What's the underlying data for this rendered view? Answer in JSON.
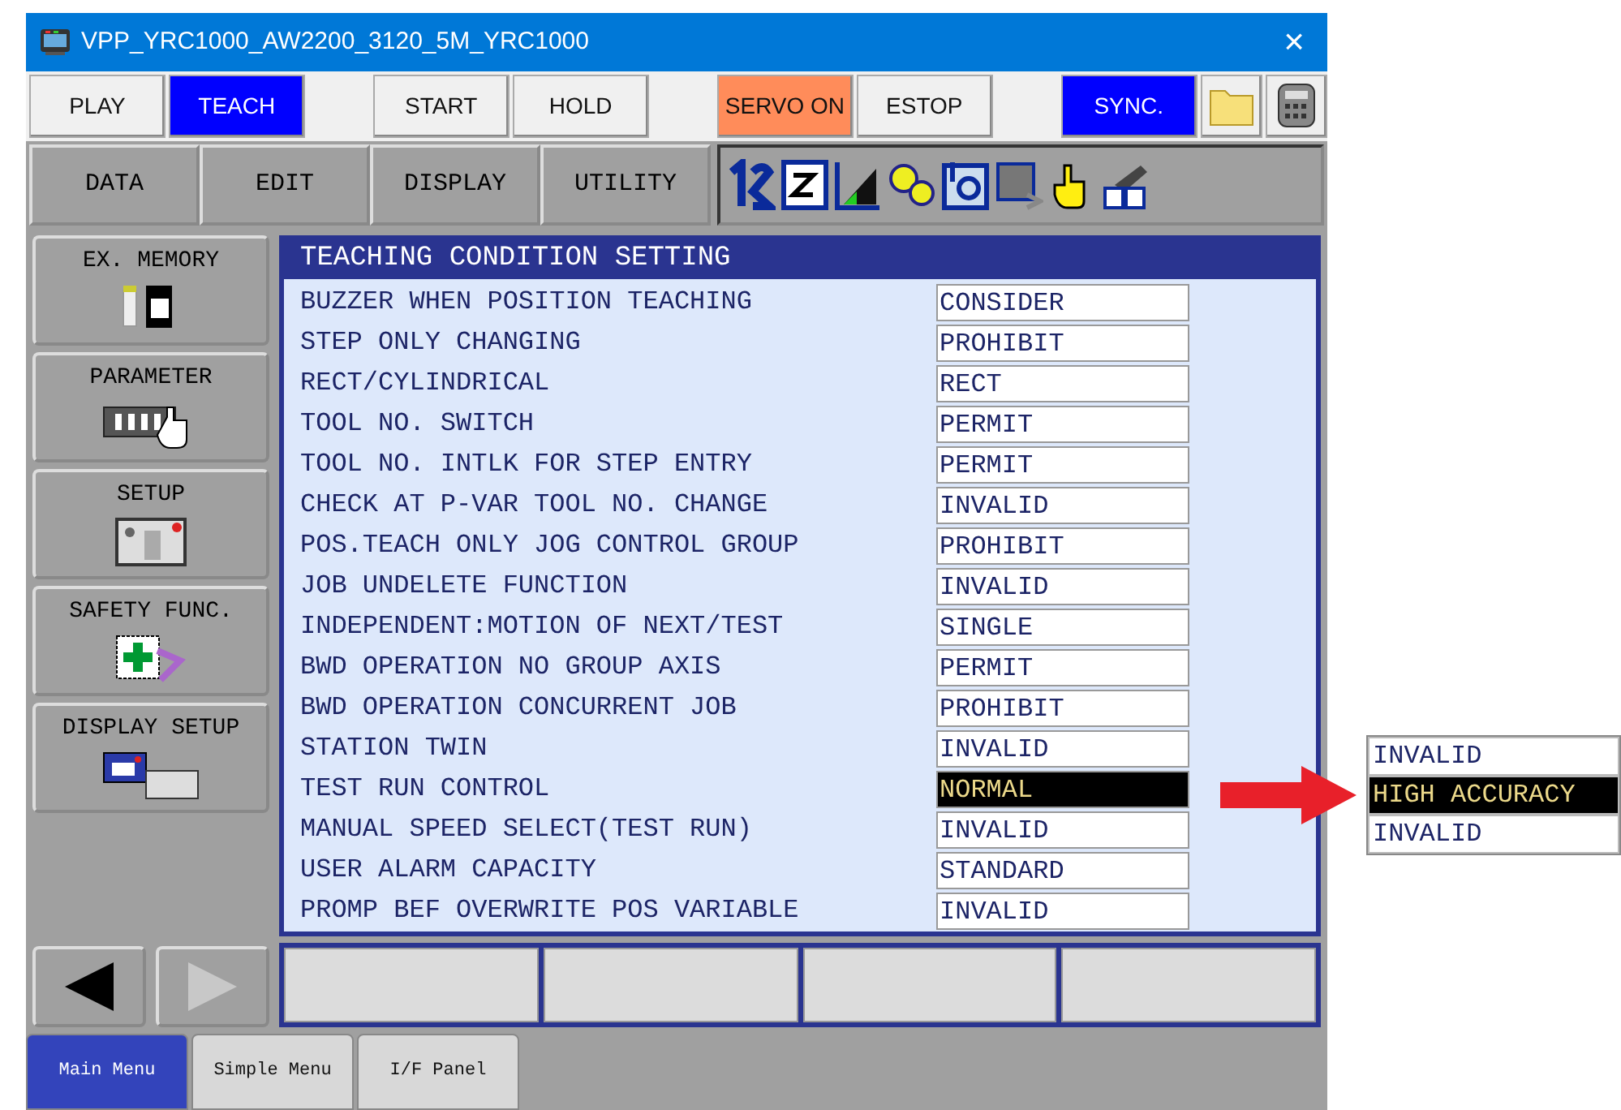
{
  "window": {
    "title": "VPP_YRC1000_AW2200_3120_5M_YRC1000",
    "close": "×"
  },
  "top_buttons": [
    {
      "label": "PLAY",
      "color": "#f0f0f0"
    },
    {
      "label": "TEACH",
      "color": "#0000ff"
    },
    {
      "label": "START",
      "color": "#f0f0f0"
    },
    {
      "label": "HOLD",
      "color": "#f0f0f0"
    },
    {
      "label": "SERVO ON",
      "color": "#ff8c5a"
    },
    {
      "label": "ESTOP",
      "color": "#f0f0f0"
    },
    {
      "label": "SYNC.",
      "color": "#0000ff"
    }
  ],
  "menu": [
    "DATA",
    "EDIT",
    "DISPLAY",
    "UTILITY"
  ],
  "sidebar": [
    "EX. MEMORY",
    "PARAMETER",
    "SETUP",
    "SAFETY FUNC.",
    "DISPLAY SETUP"
  ],
  "panel": {
    "title": "TEACHING CONDITION SETTING",
    "rows": [
      {
        "label": "BUZZER WHEN POSITION TEACHING",
        "value": "CONSIDER",
        "selected": false
      },
      {
        "label": "STEP ONLY CHANGING",
        "value": "PROHIBIT",
        "selected": false
      },
      {
        "label": "RECT/CYLINDRICAL",
        "value": "RECT",
        "selected": false
      },
      {
        "label": "TOOL NO. SWITCH",
        "value": "PERMIT",
        "selected": false
      },
      {
        "label": "TOOL NO. INTLK FOR STEP ENTRY",
        "value": "PERMIT",
        "selected": false
      },
      {
        "label": "CHECK AT P-VAR TOOL NO. CHANGE",
        "value": "INVALID",
        "selected": false
      },
      {
        "label": "POS.TEACH ONLY JOG CONTROL GROUP",
        "value": "PROHIBIT",
        "selected": false
      },
      {
        "label": "JOB UNDELETE FUNCTION",
        "value": "INVALID",
        "selected": false
      },
      {
        "label": "INDEPENDENT:MOTION OF NEXT/TEST",
        "value": "SINGLE",
        "selected": false
      },
      {
        "label": "BWD OPERATION NO GROUP AXIS",
        "value": "PERMIT",
        "selected": false
      },
      {
        "label": "BWD OPERATION CONCURRENT JOB",
        "value": "PROHIBIT",
        "selected": false
      },
      {
        "label": "STATION TWIN",
        "value": "INVALID",
        "selected": false
      },
      {
        "label": "TEST RUN CONTROL",
        "value": "NORMAL",
        "selected": true
      },
      {
        "label": "MANUAL SPEED SELECT(TEST RUN)",
        "value": "INVALID",
        "selected": false
      },
      {
        "label": "USER ALARM CAPACITY",
        "value": "STANDARD",
        "selected": false
      },
      {
        "label": "PROMP BEF OVERWRITE POS VARIABLE",
        "value": "INVALID",
        "selected": false
      }
    ]
  },
  "bottom_tabs": [
    {
      "label": "Main Menu",
      "selected": true
    },
    {
      "label": "Simple Menu",
      "selected": false
    },
    {
      "label": "I/F Panel",
      "selected": false
    }
  ],
  "dropdown": [
    {
      "label": "INVALID",
      "selected": false
    },
    {
      "label": "HIGH ACCURACY",
      "selected": true
    },
    {
      "label": "INVALID",
      "selected": false
    }
  ]
}
